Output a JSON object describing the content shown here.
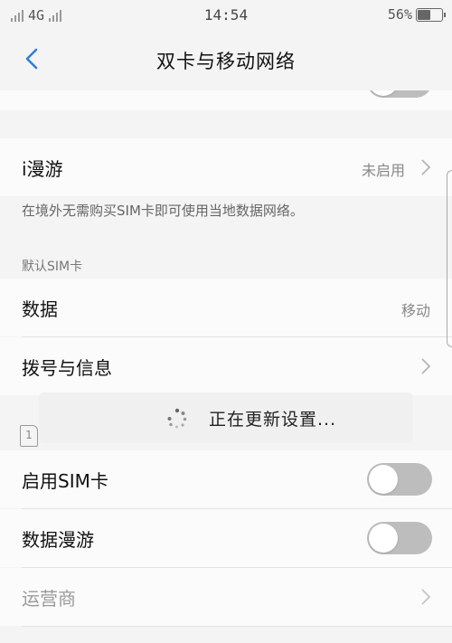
{
  "status_bar": {
    "network": "4G",
    "time": "14:54",
    "battery": "56%",
    "battery_level": 0.56
  },
  "nav": {
    "title": "双卡与移动网络",
    "back_icon": "chevron-left-icon"
  },
  "roaming": {
    "label": "i漫游",
    "value": "未启用",
    "caption": "在境外无需购买SIM卡即可使用当地数据网络。"
  },
  "default_sim": {
    "header": "默认SIM卡",
    "data_label": "数据",
    "data_value": "移动",
    "dial_label": "拨号与信息"
  },
  "toast": {
    "message": "正在更新设置..."
  },
  "sim1": {
    "badge": "1",
    "enable_label": "启用SIM卡",
    "enable_on": false,
    "roaming_label": "数据漫游",
    "roaming_on": false,
    "carrier_label": "运营商"
  },
  "colors": {
    "accent": "#2f7fd6",
    "toggle_off": "#bdbdbd"
  }
}
